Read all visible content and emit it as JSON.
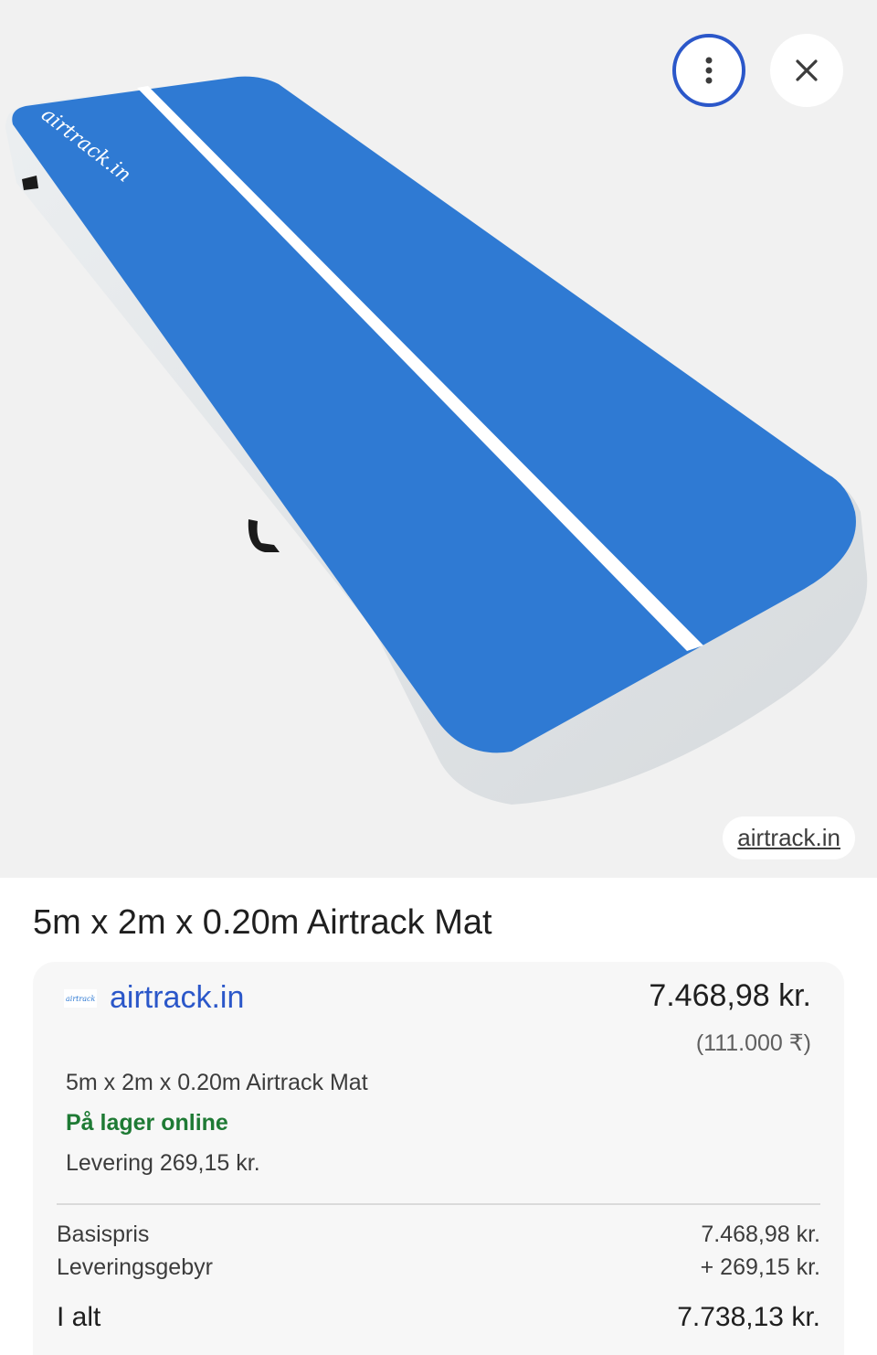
{
  "image": {
    "source_chip": "airtrack.in",
    "logo_text": "airtrack.in",
    "colors": {
      "mat_blue": "#2f7ad3",
      "mat_edge": "#dfe3e6",
      "stripe": "#ffffff"
    }
  },
  "toolbar": {
    "more_icon": "more-vert-icon",
    "close_icon": "close-icon"
  },
  "product": {
    "title": "5m x 2m x 0.20m Airtrack Mat"
  },
  "offer": {
    "seller": "airtrack.in",
    "price": "7.468,98 kr.",
    "price_original": "(111.000 ₹)",
    "description": "5m x 2m x 0.20m Airtrack Mat",
    "stock": "På lager online",
    "delivery": "Levering 269,15 kr."
  },
  "breakdown": {
    "base_label": "Basispris",
    "base_value": "7.468,98 kr.",
    "fee_label": "Leveringsgebyr",
    "fee_value": "+ 269,15 kr.",
    "total_label": "I alt",
    "total_value": "7.738,13 kr."
  }
}
